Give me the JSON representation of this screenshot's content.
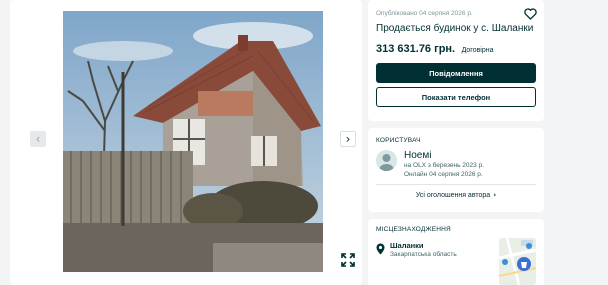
{
  "listing": {
    "posted": "Опубліковано 04 серпня 2026 р.",
    "title": "Продається будинок у с. Шаланки",
    "price": "313 631.76 грн.",
    "negotiable": "Договірна",
    "message_button": "Повідомлення",
    "phone_button": "Показати телефон"
  },
  "gallery": {
    "prev_icon": "chevron-left-icon",
    "next_icon": "chevron-right-icon",
    "fullscreen_icon": "expand-icon",
    "prev_glyph": "‹",
    "next_glyph": "›"
  },
  "user": {
    "section_title": "КОРИСТУВАЧ",
    "name": "Ноемі",
    "since": "на OLX з березень 2023 р.",
    "online": "Онлайн 04 серпня 2026 р.",
    "all_ads": "Усі оголошення автора",
    "chevron": "›"
  },
  "location": {
    "section_title": "МІСЦЕЗНАХОДЖЕННЯ",
    "city": "Шаланки",
    "region": "Закарпатська область"
  },
  "colors": {
    "primary": "#002f34",
    "background": "#f2f4f5",
    "card": "#ffffff",
    "muted": "#7f9799"
  }
}
